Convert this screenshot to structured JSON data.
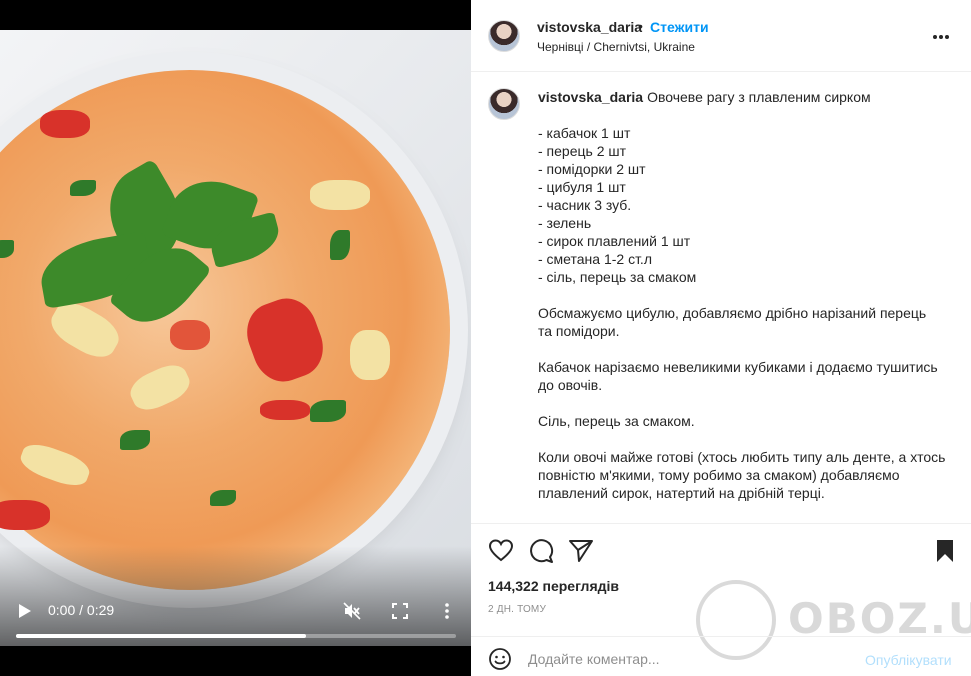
{
  "video": {
    "time_display": "0:00 / 0:29",
    "progress": 0.66
  },
  "header": {
    "username": "vistovska_daria",
    "separator": "•",
    "follow_label": "Стежити",
    "location": "Чернівці / Chernivtsi, Ukraine"
  },
  "caption": {
    "username": "vistovska_daria",
    "title": "Овочеве рагу з плавленим сирком",
    "ingredients": [
      "- кабачок 1 шт",
      "- перець 2 шт",
      "- помідорки 2 шт",
      "- цибуля 1 шт",
      "- часник 3 зуб.",
      "- зелень",
      "- сирок плавлений 1 шт",
      "- сметана 1-2 ст.л",
      "- сіль, перець за смаком"
    ],
    "para1_line1": "Обсмажуємо цибулю, добавляємо дрібно нарізаний перець",
    "para1_line2": "та помідори.",
    "para2_line1": "Кабачок нарізаємо невеликими кубиками і додаємо тушитись",
    "para2_line2": "до овочів.",
    "para3_line1": "Сіль, перець за смаком.",
    "para4_line1": "Коли овочі майже готові (хтось любить типу аль денте, а хтось",
    "para4_line2": "повністю м'якими, тому робимо за смаком) добавляємо",
    "para4_line3": "плавлений сирок, натертий на дрібній терці."
  },
  "stats": {
    "views": "144,322 переглядів",
    "date": "2 ДН. ТОМУ"
  },
  "comment": {
    "placeholder": "Додайте коментар...",
    "publish_label": "Опублікувати"
  },
  "watermark": {
    "text": "OBOZ.UA"
  },
  "icons": {
    "play": "play-icon",
    "mute": "muted-speaker-icon",
    "fullscreen": "fullscreen-icon",
    "video_more": "vertical-dots-icon",
    "post_more": "horizontal-dots-icon",
    "like": "heart-icon",
    "comment": "comment-bubble-icon",
    "share": "paper-plane-icon",
    "save": "bookmark-icon",
    "emoji": "emoji-smile-icon"
  }
}
